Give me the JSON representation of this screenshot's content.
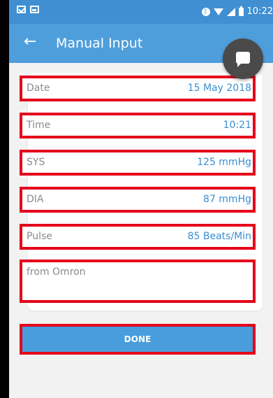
{
  "status_bar": {
    "time": "10:22",
    "icons": [
      "mail-icon",
      "image-icon",
      "bluetooth-icon",
      "wifi-icon",
      "signal-icon",
      "battery-icon"
    ]
  },
  "app_bar": {
    "title": "Manual Input",
    "back_icon": "arrow-left-icon",
    "chat_icon": "chat-bubble-icon"
  },
  "form": {
    "fields": [
      {
        "label": "Date",
        "value": "15 May 2018"
      },
      {
        "label": "Time",
        "value": "10:21"
      },
      {
        "label": "SYS",
        "value": "125 mmHg"
      },
      {
        "label": "DIA",
        "value": "87 mmHg"
      },
      {
        "label": "Pulse",
        "value": "85 Beats/Min"
      }
    ],
    "note_placeholder": "from Omron"
  },
  "actions": {
    "done_label": "DONE"
  },
  "colors": {
    "status_bar": "#3f8fd2",
    "app_bar": "#4e9edc",
    "value_text": "#3a8fd0",
    "highlight_border": "#e4001b",
    "button": "#4a9ddc",
    "fab": "#4a4a4a"
  }
}
